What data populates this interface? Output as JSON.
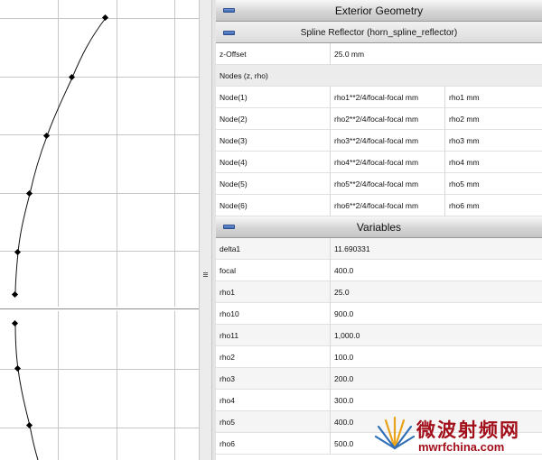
{
  "exterior_geometry": {
    "title": "Exterior Geometry",
    "spline_reflector": {
      "title": "Spline Reflector (horn_spline_reflector)",
      "z_offset": {
        "label": "z-Offset",
        "value": "25.0 mm"
      },
      "nodes_header": "Nodes (z, rho)",
      "nodes": [
        {
          "label": "Node(1)",
          "z": "rho1**2/4/focal-focal mm",
          "rho": "rho1 mm"
        },
        {
          "label": "Node(2)",
          "z": "rho2**2/4/focal-focal mm",
          "rho": "rho2 mm"
        },
        {
          "label": "Node(3)",
          "z": "rho3**2/4/focal-focal mm",
          "rho": "rho3 mm"
        },
        {
          "label": "Node(4)",
          "z": "rho4**2/4/focal-focal mm",
          "rho": "rho4 mm"
        },
        {
          "label": "Node(5)",
          "z": "rho5**2/4/focal-focal mm",
          "rho": "rho5 mm"
        },
        {
          "label": "Node(6)",
          "z": "rho6**2/4/focal-focal mm",
          "rho": "rho6 mm"
        }
      ]
    }
  },
  "variables": {
    "title": "Variables",
    "rows": [
      {
        "name": "delta1",
        "value": "11.690331"
      },
      {
        "name": "focal",
        "value": "400.0"
      },
      {
        "name": "rho1",
        "value": "25.0"
      },
      {
        "name": "rho10",
        "value": "900.0"
      },
      {
        "name": "rho11",
        "value": "1,000.0"
      },
      {
        "name": "rho2",
        "value": "100.0"
      },
      {
        "name": "rho3",
        "value": "200.0"
      },
      {
        "name": "rho4",
        "value": "300.0"
      },
      {
        "name": "rho5",
        "value": "400.0"
      },
      {
        "name": "rho6",
        "value": "500.0"
      }
    ]
  },
  "watermark": {
    "title": "微波射频网",
    "url": "mwrfchina.com"
  },
  "colors": {
    "header_text": "#111111",
    "toggle_blue": "#3c64b2",
    "watermark_red": "#a20f1a"
  }
}
